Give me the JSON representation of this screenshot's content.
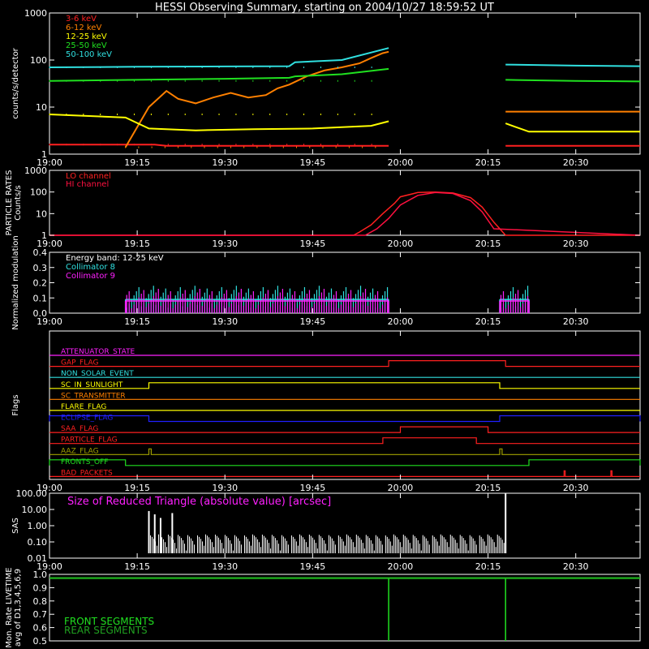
{
  "title": "HESSI Observing Summary, starting on 2004/10/27 18:59:52 UT",
  "colors": {
    "background": "#000000",
    "axes": "#ffffff",
    "red": "#ff2020",
    "orange": "#ff8000",
    "yellow": "#ffff00",
    "green": "#20e020",
    "cyan": "#30e0e0",
    "magenta": "#ff20ff",
    "blue": "#2020ff",
    "crimson": "#ff1040",
    "olive": "#a0a000",
    "darkgreen": "#20a020"
  },
  "chart_data": [
    {
      "type": "line",
      "name": "count-rates",
      "ylabel": "counts/s/detector",
      "yscale": "log",
      "ylim": [
        1,
        1000
      ],
      "yticks": [
        "1",
        "10",
        "100",
        "1000"
      ],
      "xlim": [
        "19:00",
        "20:41"
      ],
      "xticks": [
        "19:00",
        "19:15",
        "19:30",
        "19:45",
        "20:00",
        "20:15",
        "20:30"
      ],
      "legend": "top-left",
      "series": [
        {
          "name": "3-6 keV",
          "color": "red",
          "x": [
            "19:00",
            "19:13",
            "19:13",
            "19:18",
            "19:20",
            "19:41",
            "19:42",
            "19:55",
            "19:58"
          ],
          "y": [
            1.6,
            1.6,
            1.6,
            1.6,
            1.5,
            1.5,
            1.5,
            1.5,
            1.5
          ],
          "resume_x": [
            "20:18",
            "20:24",
            "20:30",
            "20:41"
          ],
          "resume_y": [
            1.5,
            1.5,
            1.5,
            1.5
          ]
        },
        {
          "name": "6-12 keV",
          "color": "orange",
          "x": [
            "19:13",
            "19:17",
            "19:20",
            "19:22",
            "19:25",
            "19:28",
            "19:31",
            "19:34",
            "19:37",
            "19:39",
            "19:41",
            "19:44",
            "19:47",
            "19:50",
            "19:53",
            "19:55",
            "19:57",
            "19:58"
          ],
          "y": [
            1.4,
            10,
            22,
            15,
            12,
            16,
            20,
            16,
            18,
            25,
            30,
            45,
            60,
            70,
            85,
            110,
            140,
            150
          ],
          "resume_x": [
            "20:18",
            "20:20",
            "20:30",
            "20:41"
          ],
          "resume_y": [
            8,
            8,
            8,
            8
          ]
        },
        {
          "name": "12-25 keV",
          "color": "yellow",
          "x": [
            "19:00",
            "19:13",
            "19:17",
            "19:25",
            "19:35",
            "19:45",
            "19:55",
            "19:58"
          ],
          "y": [
            7,
            6,
            3.5,
            3.2,
            3.4,
            3.5,
            4,
            5
          ],
          "resume_x": [
            "20:18",
            "20:22",
            "20:30",
            "20:41"
          ],
          "resume_y": [
            4.5,
            3,
            3,
            3
          ]
        },
        {
          "name": "25-50 keV",
          "color": "green",
          "x": [
            "19:00",
            "19:15",
            "19:30",
            "19:41",
            "19:42",
            "19:50",
            "19:58"
          ],
          "y": [
            36,
            38,
            40,
            42,
            45,
            50,
            65
          ],
          "resume_x": [
            "20:18",
            "20:30",
            "20:41"
          ],
          "resume_y": [
            38,
            36,
            35
          ]
        },
        {
          "name": "50-100 keV",
          "color": "cyan",
          "x": [
            "19:00",
            "19:15",
            "19:30",
            "19:41",
            "19:42",
            "19:50",
            "19:58"
          ],
          "y": [
            70,
            72,
            73,
            74,
            90,
            100,
            180
          ],
          "resume_x": [
            "20:18",
            "20:30",
            "20:41"
          ],
          "resume_y": [
            80,
            76,
            74
          ]
        }
      ]
    },
    {
      "type": "line",
      "name": "particle-rates",
      "ylabel": "PARTICLE RATES Counts/s",
      "yscale": "log",
      "ylim": [
        1,
        1000
      ],
      "yticks": [
        "1",
        "10",
        "100",
        "1000"
      ],
      "xticks": [
        "19:00",
        "19:15",
        "19:30",
        "19:45",
        "20:00",
        "20:15",
        "20:30"
      ],
      "legend": "top-left",
      "series": [
        {
          "name": "LO channel",
          "color": "red",
          "x": [
            "19:00",
            "19:52",
            "19:53",
            "19:55",
            "19:57",
            "19:59",
            "20:00",
            "20:03",
            "20:06",
            "20:09",
            "20:12",
            "20:14",
            "20:16",
            "20:18",
            "20:41"
          ],
          "y": [
            1,
            1,
            1.4,
            3,
            10,
            30,
            60,
            95,
            100,
            90,
            55,
            20,
            4,
            1,
            1
          ]
        },
        {
          "name": "HI channel",
          "color": "crimson",
          "x": [
            "19:00",
            "19:54",
            "19:56",
            "19:58",
            "20:00",
            "20:03",
            "20:06",
            "20:09",
            "20:12",
            "20:14",
            "20:16",
            "20:41"
          ],
          "y": [
            1,
            1,
            2,
            6,
            25,
            70,
            95,
            85,
            40,
            12,
            2,
            1
          ]
        }
      ]
    },
    {
      "type": "line",
      "name": "modulation",
      "ylabel": "Normalized modulation",
      "ylim": [
        0,
        0.4
      ],
      "yticks": [
        "0.0",
        "0.1",
        "0.2",
        "0.3",
        "0.4"
      ],
      "xticks": [
        "19:00",
        "19:15",
        "19:30",
        "19:45",
        "20:00",
        "20:15",
        "20:30"
      ],
      "legend": "top-left",
      "annotation": "Energy band: 12-25 keV",
      "series": [
        {
          "name": "Collimator 8",
          "color": "cyan",
          "x_start": "19:13",
          "x_end": "19:58",
          "level": 0.09,
          "resume_start": "20:17",
          "resume_end": "20:22"
        },
        {
          "name": "Collimator 9",
          "color": "magenta",
          "x_start": "19:13",
          "x_end": "19:58",
          "level": 0.08,
          "resume_start": "20:17",
          "resume_end": "20:22"
        }
      ]
    },
    {
      "type": "step",
      "name": "flags",
      "ylabel": "Flags",
      "xticks": [
        "19:00",
        "19:15",
        "19:30",
        "19:45",
        "20:00",
        "20:15",
        "20:30"
      ],
      "flags": [
        {
          "label": "ATTENUATOR_STATE",
          "color": "magenta",
          "on": []
        },
        {
          "label": "GAP_FLAG",
          "color": "red",
          "on": [
            [
              "19:58",
              "20:18"
            ]
          ]
        },
        {
          "label": "NON_SOLAR_EVENT",
          "color": "cyan",
          "on": []
        },
        {
          "label": "SC_IN_SUNLIGHT",
          "color": "yellow",
          "on": [
            [
              "19:17",
              "20:17"
            ]
          ]
        },
        {
          "label": "SC_TRANSMITTER",
          "color": "orange",
          "on": []
        },
        {
          "label": "FLARE_FLAG",
          "color": "yellow",
          "on": []
        },
        {
          "label": "ECLIPSE_FLAG",
          "color": "blue",
          "on": [
            [
              "19:00",
              "19:17"
            ],
            [
              "20:17",
              "20:41"
            ]
          ]
        },
        {
          "label": "SAA_FLAG",
          "color": "red",
          "on": [
            [
              "20:00",
              "20:15"
            ]
          ]
        },
        {
          "label": "PARTICLE_FLAG",
          "color": "red",
          "on": [
            [
              "19:57",
              "20:13"
            ]
          ]
        },
        {
          "label": "AAZ_FLAG",
          "color": "olive",
          "on": [
            [
              "19:17",
              "19:17.4"
            ],
            [
              "20:17",
              "20:17.4"
            ]
          ]
        },
        {
          "label": "FRONTS_OFF",
          "color": "green",
          "on": [
            [
              "19:00",
              "19:13"
            ],
            [
              "20:22",
              "20:41"
            ]
          ]
        },
        {
          "label": "BAD_PACKETS",
          "color": "red",
          "on": [
            [
              "20:28",
              "20:28.2"
            ],
            [
              "20:36",
              "20:36.2"
            ]
          ]
        }
      ]
    },
    {
      "type": "line",
      "name": "sas",
      "ylabel": "SAS",
      "yscale": "log",
      "ylim": [
        0.01,
        100
      ],
      "yticks": [
        "0.01",
        "0.10",
        "1.00",
        "10.00",
        "100.00"
      ],
      "xticks": [
        "19:00",
        "19:15",
        "19:30",
        "19:45",
        "20:00",
        "20:15",
        "20:30"
      ],
      "annotation": "Size of Reduced Triangle (absolute value) [arcsec]",
      "series": [
        {
          "name": "Size of Reduced Triangle",
          "color": "white",
          "x_start": "19:17",
          "x_end": "20:18",
          "y_low": 0.02,
          "y_high": 0.3,
          "spikes_x": [
            "19:17",
            "19:18",
            "19:19",
            "19:21",
            "20:18"
          ],
          "spikes_y": [
            8,
            5,
            3,
            6,
            100
          ]
        }
      ]
    },
    {
      "type": "line",
      "name": "livetime",
      "ylabel": "Mon. Rate LIVETIME avg of D1,3,4,5,6,9",
      "ylim": [
        0.5,
        1.0
      ],
      "yticks": [
        "0.5",
        "0.6",
        "0.7",
        "0.8",
        "0.9",
        "1.0"
      ],
      "legend": "bottom-left",
      "series": [
        {
          "name": "FRONT SEGMENTS",
          "color": "green",
          "x": [
            "19:00",
            "19:58",
            "19:58",
            "19:58",
            "20:18",
            "20:18",
            "20:18",
            "20:41"
          ],
          "y": [
            0.97,
            0.97,
            0.5,
            0.97,
            0.97,
            0.5,
            0.97,
            0.97
          ]
        },
        {
          "name": "REAR SEGMENTS",
          "color": "darkgreen",
          "x": [
            "19:00",
            "19:58",
            "20:18",
            "20:41"
          ],
          "y": [
            0.975,
            0.975,
            0.975,
            0.975
          ]
        }
      ]
    }
  ]
}
